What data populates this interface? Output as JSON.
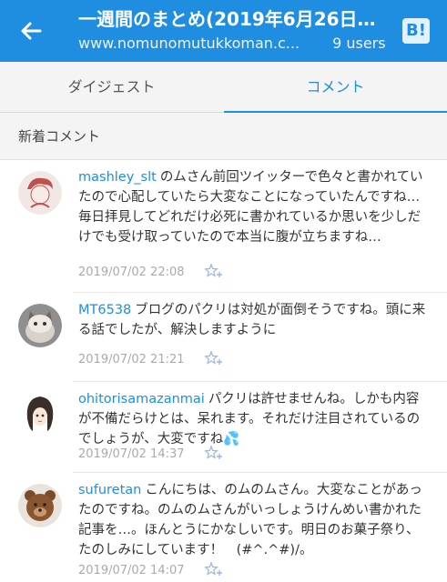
{
  "appbar": {
    "title": "一週間のまとめ(2019年6月26日…",
    "url": "www.nomunomutukkoman.c...",
    "users": "9 users",
    "badge": "B!"
  },
  "tabs": [
    {
      "label": "ダイジェスト",
      "active": false
    },
    {
      "label": "コメント",
      "active": true
    }
  ],
  "section_title": "新着コメント",
  "comments": [
    {
      "user": "mashley_slt",
      "text": "のムさん前回ツイッターで色々と書かれていたので心配していたら大変なことになっていたんですね…毎日拝見してどれだけ必死に書かれているか思いを少しだけでも受け取っていたので本当に腹が立ちますね…",
      "time": "2019/07/02 22:08"
    },
    {
      "user": "MT6538",
      "text": "ブログのパクリは対処が面倒そうですね。頭に来る話でしたが、解決しますように",
      "time": "2019/07/02 21:21"
    },
    {
      "user": "ohitorisamazanmai",
      "text": "パクリは許せませんね。しかも内容が不備だらけとは、呆れます。それだけ注目されているのでしょうが、大変ですね💦",
      "time": "2019/07/02 14:37"
    },
    {
      "user": "sufuretan",
      "text": "こんにちは、のムのムさん。大変なことがあったのですね。のムのムさんがいっしょうけんめい書かれた記事を…。ほんとうにかなしいです。明日のお菓子祭り、たのしみにしています！　(#^.^#)/。",
      "time": "2019/07/02 14:07"
    }
  ],
  "colors": {
    "accent": "#1f8ee0",
    "tabbar": "#f4f4f4"
  }
}
